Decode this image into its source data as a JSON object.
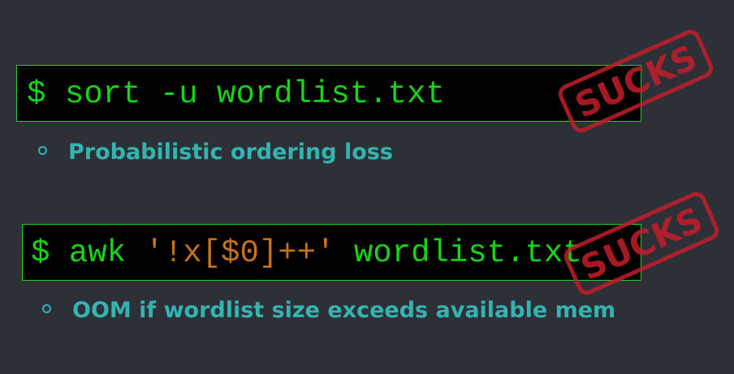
{
  "commands": [
    {
      "prompt": "$ ",
      "parts": [
        {
          "text": "sort -u wordlist.txt",
          "style": "plain"
        }
      ],
      "stamp": "SUCKS"
    },
    {
      "prompt": "$ ",
      "parts": [
        {
          "text": "awk ",
          "style": "plain"
        },
        {
          "text": "'!x[$0]++'",
          "style": "quoted"
        },
        {
          "text": " wordlist.txt",
          "style": "plain"
        }
      ],
      "stamp": "SUCKS"
    }
  ],
  "bullets": [
    "Probabilistic ordering loss",
    "OOM if wordlist size exceeds available mem"
  ],
  "colors": {
    "background": "#2e3037",
    "terminal_bg": "#000000",
    "terminal_border": "#1fd31f",
    "command_green": "#16d416",
    "quoted_orange": "#c8711b",
    "bullet_teal": "#33b4b0",
    "stamp_red": "#c41e2a"
  },
  "icons": {
    "bullet": "hollow-circle-icon",
    "stamp": "sucks-rubber-stamp-icon"
  }
}
